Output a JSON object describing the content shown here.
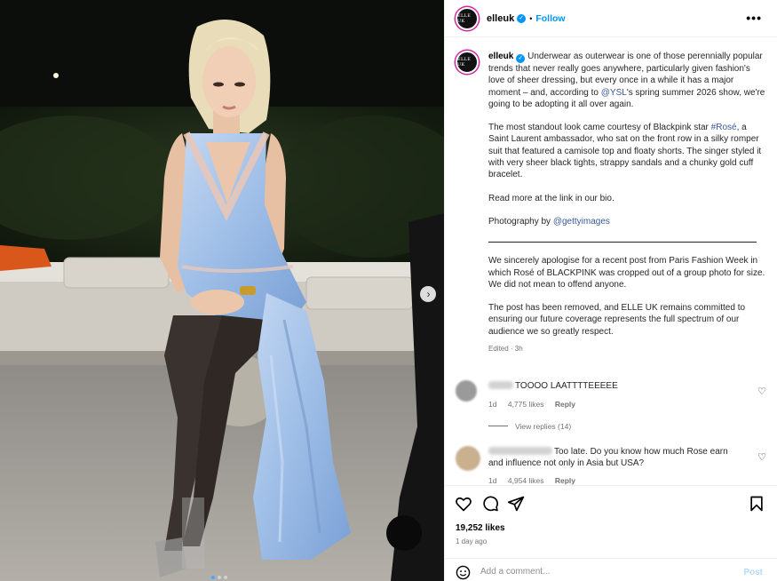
{
  "header": {
    "avatar_text": "ELLE UK",
    "username": "elleuk",
    "separator": "•",
    "follow_label": "Follow",
    "more_label": "•••"
  },
  "caption": {
    "username": "elleuk",
    "p1_a": " Underwear as outerwear is one of those perennially popular trends that never really goes anywhere, particularly given fashion's love of sheer dressing, but every once in a while it has a major moment – and, according to ",
    "p1_link": "@YSL",
    "p1_b": "'s spring summer 2026 show, we're going to be adopting it all over again.",
    "p2_a": "The most standout look came courtesy of Blackpink star ",
    "p2_link": "#Rosé",
    "p2_b": ", a Saint Laurent ambassador, who sat on the front row in a silky romper suit that featured a camisole top and floaty shorts. The singer styled it with very sheer black tights, strappy sandals and a chunky gold cuff bracelet.",
    "p3": "Read more at the link in our bio.",
    "p4_a": "Photography by ",
    "p4_link": "@gettyimages",
    "p5": "We sincerely apologise for a recent post from Paris Fashion Week in which Rosé of BLACKPINK was cropped out of a group photo for size. We did not mean to offend anyone.",
    "p6": "The post has been removed, and ELLE UK remains committed to ensuring our future coverage represents the full spectrum of our audience we so greatly respect.",
    "edited": "Edited · 3h"
  },
  "comments": [
    {
      "text": "TOOOO LAATTTTEEEEE",
      "age": "1d",
      "likes": "4,775 likes",
      "reply": "Reply",
      "view_replies": "View replies (14)"
    },
    {
      "text": "Too late. Do you know how much Rose earn and influence not only in Asia but USA?",
      "age": "1d",
      "likes": "4,954 likes",
      "reply": "Reply"
    }
  ],
  "footer": {
    "likes": "19,252 likes",
    "ago": "1 day ago",
    "add_placeholder": "Add a comment...",
    "post_label": "Post"
  },
  "icons": [
    "verified-icon",
    "heart-icon",
    "comment-icon",
    "share-icon",
    "bookmark-icon",
    "emoji-icon",
    "chevron-right-icon"
  ],
  "colors": {
    "accent": "#0095f6",
    "link": "#385898",
    "dress": "#a9c6ea"
  }
}
